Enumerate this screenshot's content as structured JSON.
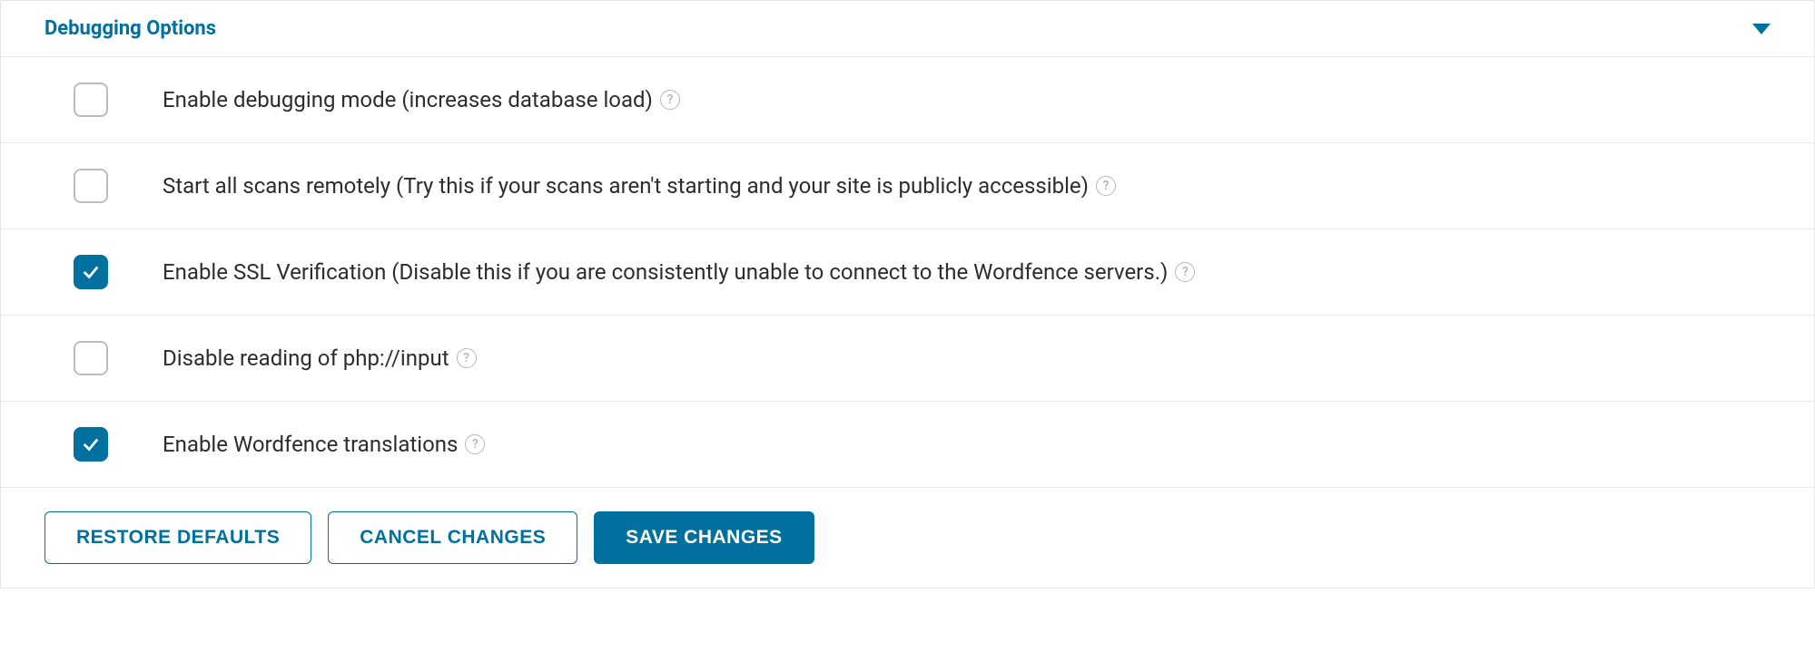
{
  "panel": {
    "title": "Debugging Options"
  },
  "options": [
    {
      "label": "Enable debugging mode (increases database load)",
      "checked": false
    },
    {
      "label": "Start all scans remotely (Try this if your scans aren't starting and your site is publicly accessible)",
      "checked": false
    },
    {
      "label": "Enable SSL Verification (Disable this if you are consistently unable to connect to the Wordfence servers.)",
      "checked": true
    },
    {
      "label": "Disable reading of php://input",
      "checked": false
    },
    {
      "label": "Enable Wordfence translations",
      "checked": true
    }
  ],
  "buttons": {
    "restore": "RESTORE DEFAULTS",
    "cancel": "CANCEL CHANGES",
    "save": "SAVE CHANGES"
  }
}
